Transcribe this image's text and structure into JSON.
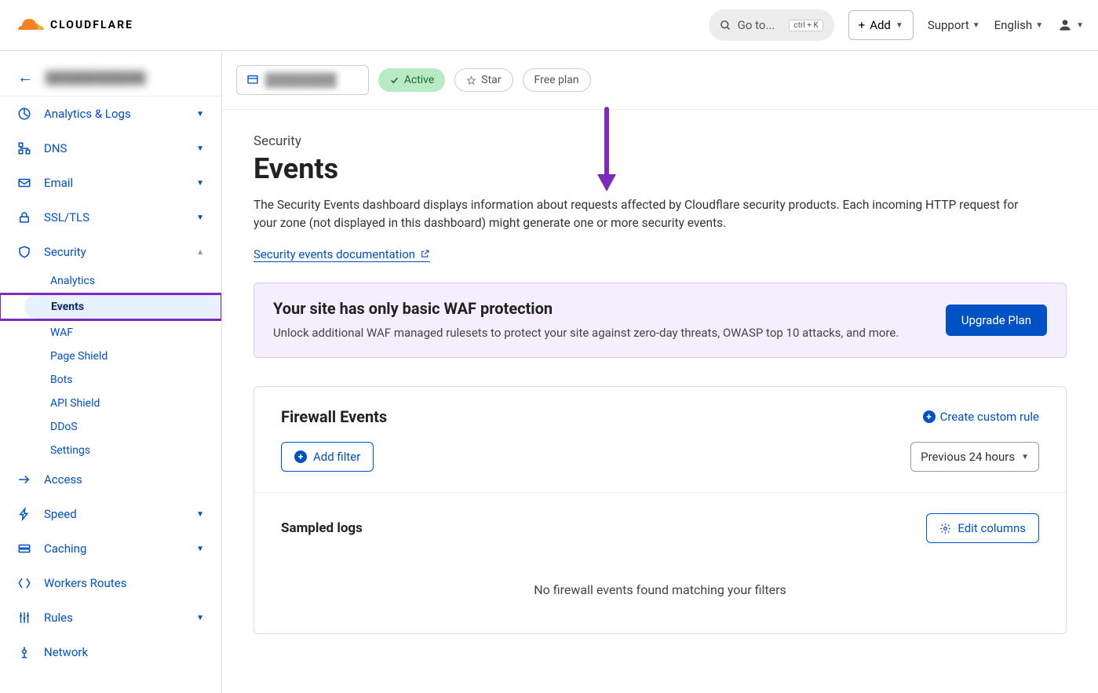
{
  "header": {
    "brand": "CLOUDFLARE",
    "search_placeholder": "Go to...",
    "search_shortcut": "ctrl + K",
    "add_label": "Add",
    "support_label": "Support",
    "language_label": "English"
  },
  "sidebar": {
    "items": [
      {
        "label": "Analytics & Logs",
        "expandable": true
      },
      {
        "label": "DNS",
        "expandable": true
      },
      {
        "label": "Email",
        "expandable": true
      },
      {
        "label": "SSL/TLS",
        "expandable": true
      },
      {
        "label": "Security",
        "expandable": true,
        "expanded": true,
        "subs": [
          {
            "label": "Analytics"
          },
          {
            "label": "Events",
            "active": true
          },
          {
            "label": "WAF"
          },
          {
            "label": "Page Shield"
          },
          {
            "label": "Bots"
          },
          {
            "label": "API Shield"
          },
          {
            "label": "DDoS"
          },
          {
            "label": "Settings"
          }
        ]
      },
      {
        "label": "Access"
      },
      {
        "label": "Speed",
        "expandable": true
      },
      {
        "label": "Caching",
        "expandable": true
      },
      {
        "label": "Workers Routes"
      },
      {
        "label": "Rules",
        "expandable": true
      },
      {
        "label": "Network"
      }
    ]
  },
  "domain_bar": {
    "status": "Active",
    "star": "Star",
    "plan": "Free plan"
  },
  "page": {
    "crumb": "Security",
    "title": "Events",
    "description": "The Security Events dashboard displays information about requests affected by Cloudflare security products. Each incoming HTTP request for your zone (not displayed in this dashboard) might generate one or more security events.",
    "doc_link": "Security events documentation"
  },
  "banner": {
    "title": "Your site has only basic WAF protection",
    "desc": "Unlock additional WAF managed rulesets to protect your site against zero-day threats, OWASP top 10 attacks, and more.",
    "button": "Upgrade Plan"
  },
  "firewall": {
    "title": "Firewall Events",
    "create_link": "Create custom rule",
    "add_filter": "Add filter",
    "time_range": "Previous 24 hours"
  },
  "sampled": {
    "title": "Sampled logs",
    "edit_cols": "Edit columns",
    "empty": "No firewall events found matching your filters"
  }
}
